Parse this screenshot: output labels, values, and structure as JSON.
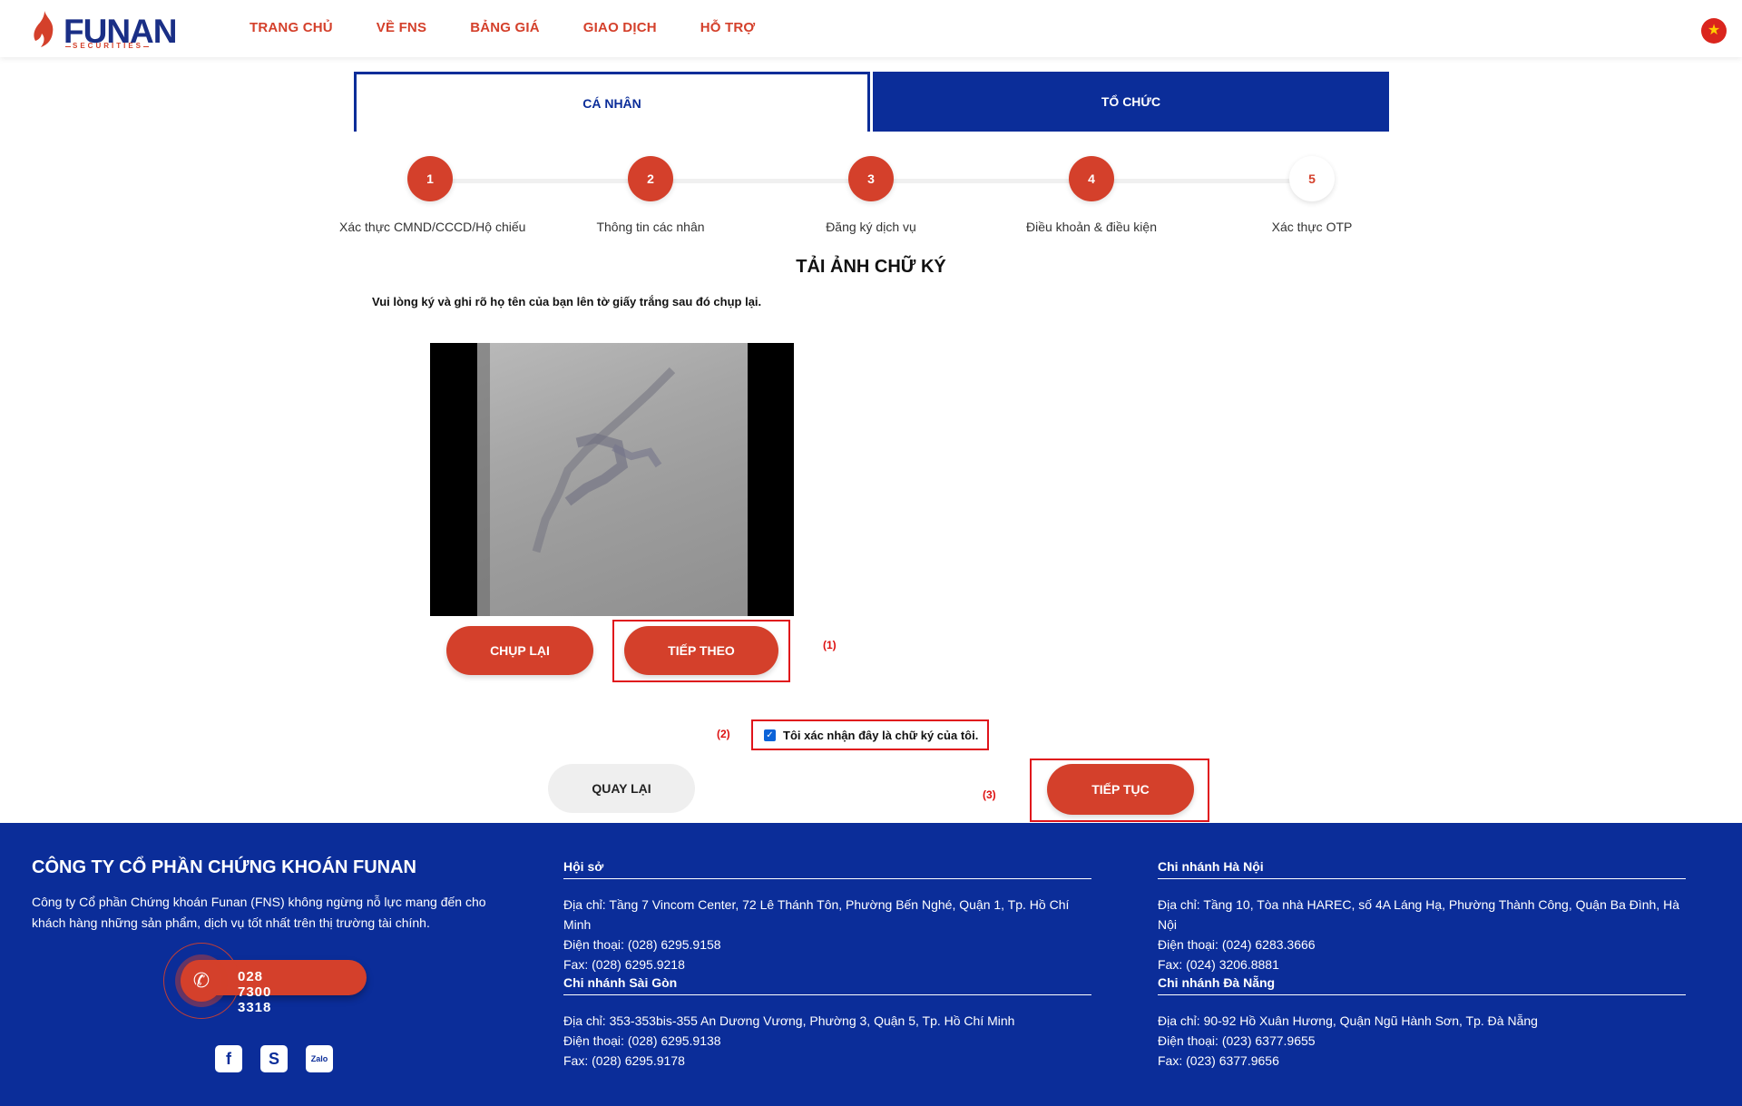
{
  "header": {
    "logo_text": "FUNAN",
    "logo_sub": "SECURITIES",
    "nav": [
      "TRANG CHỦ",
      "VỀ FNS",
      "BẢNG GIÁ",
      "GIAO DỊCH",
      "HỖ TRỢ"
    ],
    "flag_icon": "vietnam-flag-icon"
  },
  "tabs": {
    "personal": "CÁ NHÂN",
    "organization": "TỔ CHỨC"
  },
  "steps": [
    {
      "number": "1",
      "label": "Xác thực CMND/CCCD/Hộ chiếu"
    },
    {
      "number": "2",
      "label": "Thông tin các nhân"
    },
    {
      "number": "3",
      "label": "Đăng ký dịch vụ"
    },
    {
      "number": "4",
      "label": "Điều khoản & điều kiện"
    },
    {
      "number": "5",
      "label": "Xác thực OTP"
    }
  ],
  "main": {
    "title": "TẢI ẢNH CHỮ KÝ",
    "instruction": "Vui lòng ký và ghi rõ họ tên của bạn lên tờ giấy trắng sau đó chụp lại.",
    "retake_label": "CHỤP LẠI",
    "next_label": "TIẾP THEO",
    "confirm_label": "Tôi xác nhận đây là chữ ký của tôi.",
    "confirm_checked": true,
    "back_label": "QUAY LẠI",
    "continue_label": "TIẾP TỤC",
    "annotations": [
      "(1)",
      "(2)",
      "(3)"
    ]
  },
  "footer": {
    "company": "CÔNG TY CỔ PHẦN CHỨNG KHOÁN FUNAN",
    "description": "Công ty Cổ phần Chứng khoán Funan (FNS) không ngừng nỗ lực mang đến cho khách hàng những sản phẩm, dịch vụ tốt nhất trên thị trường tài chính.",
    "hotline": "028 7300 3318",
    "socials": [
      "facebook-icon",
      "skype-icon",
      "zalo-icon"
    ],
    "offices": [
      {
        "title": "Hội sở",
        "address": "Địa chỉ: Tầng 7 Vincom Center, 72 Lê Thánh Tôn, Phường Bến Nghé, Quận 1, Tp. Hồ Chí Minh",
        "phone": "Điện thoại: (028) 6295.9158",
        "fax": "Fax: (028) 6295.9218"
      },
      {
        "title": "Chi nhánh Hà Nội",
        "address": "Địa chỉ: Tầng 10, Tòa nhà HAREC, số 4A Láng Hạ, Phường Thành Công, Quận Ba Đình, Hà Nội",
        "phone": "Điện thoại: (024) 6283.3666",
        "fax": "Fax: (024) 3206.8881"
      },
      {
        "title": "Chi nhánh Sài Gòn",
        "address": "Địa chỉ: 353-353bis-355 An Dương Vương, Phường 3, Quận 5, Tp. Hồ Chí Minh",
        "phone": "Điện thoại: (028) 6295.9138",
        "fax": "Fax: (028) 6295.9178"
      },
      {
        "title": "Chi nhánh Đà Nẵng",
        "address": "Địa chỉ: 90-92 Hồ Xuân Hương, Quận Ngũ Hành Sơn, Tp. Đà Nẵng",
        "phone": "Điện thoại: (023) 6377.9655",
        "fax": "Fax: (023) 6377.9656"
      }
    ]
  },
  "colors": {
    "brand_red": "#d4402b",
    "brand_blue": "#0b2d99",
    "annotation_red": "#e0141b"
  }
}
